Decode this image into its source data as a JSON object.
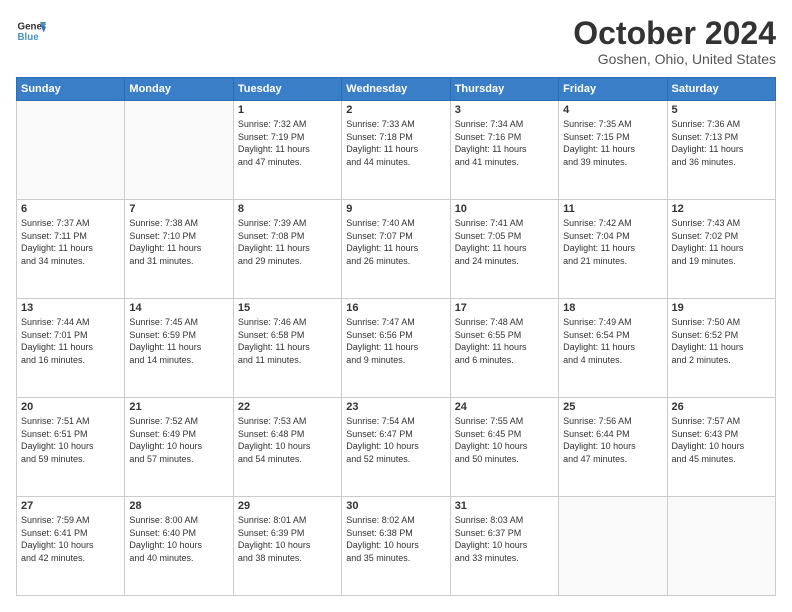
{
  "header": {
    "logo_line1": "General",
    "logo_line2": "Blue",
    "month": "October 2024",
    "location": "Goshen, Ohio, United States"
  },
  "weekdays": [
    "Sunday",
    "Monday",
    "Tuesday",
    "Wednesday",
    "Thursday",
    "Friday",
    "Saturday"
  ],
  "weeks": [
    [
      {
        "day": "",
        "info": ""
      },
      {
        "day": "",
        "info": ""
      },
      {
        "day": "1",
        "info": "Sunrise: 7:32 AM\nSunset: 7:19 PM\nDaylight: 11 hours\nand 47 minutes."
      },
      {
        "day": "2",
        "info": "Sunrise: 7:33 AM\nSunset: 7:18 PM\nDaylight: 11 hours\nand 44 minutes."
      },
      {
        "day": "3",
        "info": "Sunrise: 7:34 AM\nSunset: 7:16 PM\nDaylight: 11 hours\nand 41 minutes."
      },
      {
        "day": "4",
        "info": "Sunrise: 7:35 AM\nSunset: 7:15 PM\nDaylight: 11 hours\nand 39 minutes."
      },
      {
        "day": "5",
        "info": "Sunrise: 7:36 AM\nSunset: 7:13 PM\nDaylight: 11 hours\nand 36 minutes."
      }
    ],
    [
      {
        "day": "6",
        "info": "Sunrise: 7:37 AM\nSunset: 7:11 PM\nDaylight: 11 hours\nand 34 minutes."
      },
      {
        "day": "7",
        "info": "Sunrise: 7:38 AM\nSunset: 7:10 PM\nDaylight: 11 hours\nand 31 minutes."
      },
      {
        "day": "8",
        "info": "Sunrise: 7:39 AM\nSunset: 7:08 PM\nDaylight: 11 hours\nand 29 minutes."
      },
      {
        "day": "9",
        "info": "Sunrise: 7:40 AM\nSunset: 7:07 PM\nDaylight: 11 hours\nand 26 minutes."
      },
      {
        "day": "10",
        "info": "Sunrise: 7:41 AM\nSunset: 7:05 PM\nDaylight: 11 hours\nand 24 minutes."
      },
      {
        "day": "11",
        "info": "Sunrise: 7:42 AM\nSunset: 7:04 PM\nDaylight: 11 hours\nand 21 minutes."
      },
      {
        "day": "12",
        "info": "Sunrise: 7:43 AM\nSunset: 7:02 PM\nDaylight: 11 hours\nand 19 minutes."
      }
    ],
    [
      {
        "day": "13",
        "info": "Sunrise: 7:44 AM\nSunset: 7:01 PM\nDaylight: 11 hours\nand 16 minutes."
      },
      {
        "day": "14",
        "info": "Sunrise: 7:45 AM\nSunset: 6:59 PM\nDaylight: 11 hours\nand 14 minutes."
      },
      {
        "day": "15",
        "info": "Sunrise: 7:46 AM\nSunset: 6:58 PM\nDaylight: 11 hours\nand 11 minutes."
      },
      {
        "day": "16",
        "info": "Sunrise: 7:47 AM\nSunset: 6:56 PM\nDaylight: 11 hours\nand 9 minutes."
      },
      {
        "day": "17",
        "info": "Sunrise: 7:48 AM\nSunset: 6:55 PM\nDaylight: 11 hours\nand 6 minutes."
      },
      {
        "day": "18",
        "info": "Sunrise: 7:49 AM\nSunset: 6:54 PM\nDaylight: 11 hours\nand 4 minutes."
      },
      {
        "day": "19",
        "info": "Sunrise: 7:50 AM\nSunset: 6:52 PM\nDaylight: 11 hours\nand 2 minutes."
      }
    ],
    [
      {
        "day": "20",
        "info": "Sunrise: 7:51 AM\nSunset: 6:51 PM\nDaylight: 10 hours\nand 59 minutes."
      },
      {
        "day": "21",
        "info": "Sunrise: 7:52 AM\nSunset: 6:49 PM\nDaylight: 10 hours\nand 57 minutes."
      },
      {
        "day": "22",
        "info": "Sunrise: 7:53 AM\nSunset: 6:48 PM\nDaylight: 10 hours\nand 54 minutes."
      },
      {
        "day": "23",
        "info": "Sunrise: 7:54 AM\nSunset: 6:47 PM\nDaylight: 10 hours\nand 52 minutes."
      },
      {
        "day": "24",
        "info": "Sunrise: 7:55 AM\nSunset: 6:45 PM\nDaylight: 10 hours\nand 50 minutes."
      },
      {
        "day": "25",
        "info": "Sunrise: 7:56 AM\nSunset: 6:44 PM\nDaylight: 10 hours\nand 47 minutes."
      },
      {
        "day": "26",
        "info": "Sunrise: 7:57 AM\nSunset: 6:43 PM\nDaylight: 10 hours\nand 45 minutes."
      }
    ],
    [
      {
        "day": "27",
        "info": "Sunrise: 7:59 AM\nSunset: 6:41 PM\nDaylight: 10 hours\nand 42 minutes."
      },
      {
        "day": "28",
        "info": "Sunrise: 8:00 AM\nSunset: 6:40 PM\nDaylight: 10 hours\nand 40 minutes."
      },
      {
        "day": "29",
        "info": "Sunrise: 8:01 AM\nSunset: 6:39 PM\nDaylight: 10 hours\nand 38 minutes."
      },
      {
        "day": "30",
        "info": "Sunrise: 8:02 AM\nSunset: 6:38 PM\nDaylight: 10 hours\nand 35 minutes."
      },
      {
        "day": "31",
        "info": "Sunrise: 8:03 AM\nSunset: 6:37 PM\nDaylight: 10 hours\nand 33 minutes."
      },
      {
        "day": "",
        "info": ""
      },
      {
        "day": "",
        "info": ""
      }
    ]
  ]
}
